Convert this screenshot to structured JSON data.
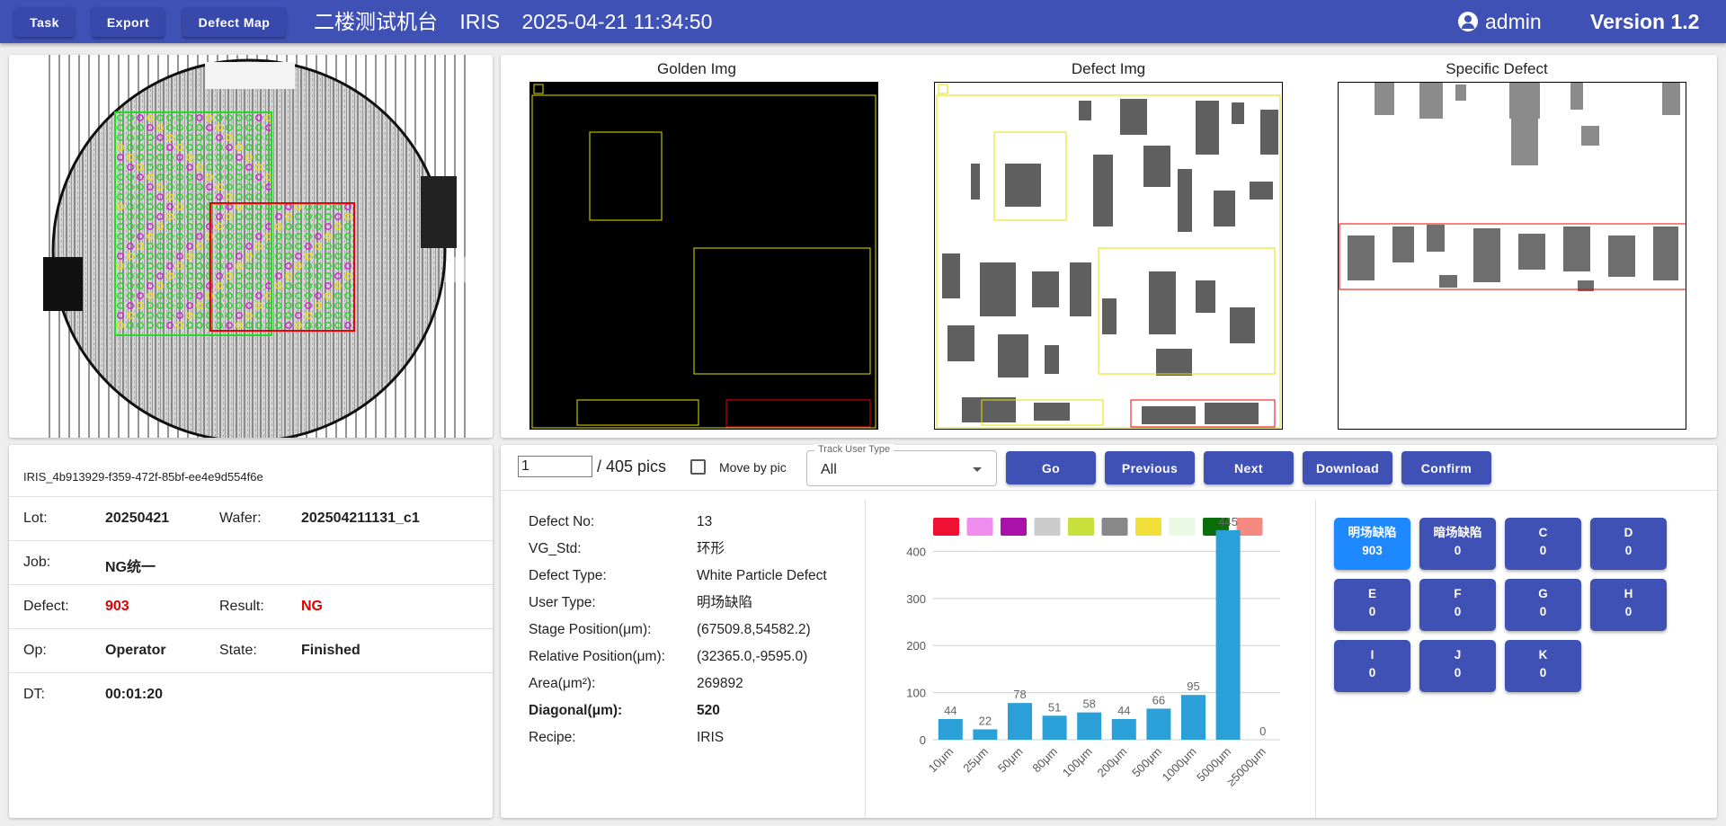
{
  "toolbar": {
    "task": "Task",
    "export": "Export",
    "defect_map": "Defect Map",
    "station": "二楼测试机台",
    "system": "IRIS",
    "datetime": "2025-04-21 11:34:50",
    "user": "admin",
    "version": "Version 1.2"
  },
  "images": {
    "golden_title": "Golden Img",
    "defect_title": "Defect Img",
    "specific_title": "Specific Defect"
  },
  "info": {
    "id": "IRIS_4b913929-f359-472f-85bf-ee4e9d554f6e",
    "lot_label": "Lot:",
    "lot": "20250421",
    "wafer_label": "Wafer:",
    "wafer": "202504211131_c1",
    "job_label": "Job:",
    "job": "NG统一",
    "defect_label": "Defect:",
    "defect": "903",
    "result_label": "Result:",
    "result": "NG",
    "op_label": "Op:",
    "op": "Operator",
    "state_label": "State:",
    "state": "Finished",
    "dt_label": "DT:",
    "dt": "00:01:20"
  },
  "controls": {
    "pic_value": "1",
    "pic_total": "/ 405 pics",
    "move_by_pic": "Move by pic",
    "move_by_pic_checked": false,
    "track_label": "Track User Type",
    "track_value": "All",
    "go": "Go",
    "previous": "Previous",
    "next": "Next",
    "download": "Download",
    "confirm": "Confirm"
  },
  "defect": {
    "no_label": "Defect No:",
    "no": "13",
    "vg_label": "VG_Std:",
    "vg": "环形",
    "type_label": "Defect Type:",
    "type": "White Particle Defect",
    "user_type_label": "User Type:",
    "user_type": "明场缺陷",
    "stage_label": "Stage Position(μm):",
    "stage": "(67509.8,54582.2)",
    "rel_label": "Relative Position(μm):",
    "rel": "(32365.0,-9595.0)",
    "area_label": "Area(μm²):",
    "area": "269892",
    "diag_label": "Diagonal(μm):",
    "diag": "520",
    "recipe_label": "Recipe:",
    "recipe": "IRIS"
  },
  "legend_colors": [
    "#ee1133",
    "#f08ef0",
    "#aa11aa",
    "#cccccc",
    "#c8e03c",
    "#888888",
    "#f2df3a",
    "#e9f9e4",
    "#0a6e0a",
    "#f58a80"
  ],
  "chart_data": {
    "type": "bar",
    "categories": [
      "10μm",
      "25μm",
      "50μm",
      "80μm",
      "100μm",
      "200μm",
      "500μm",
      "1000μm",
      "5000μm",
      "≥5000μm"
    ],
    "values": [
      44,
      22,
      78,
      51,
      58,
      44,
      66,
      95,
      445,
      0
    ],
    "yticks": [
      0,
      100,
      200,
      300,
      400
    ],
    "ylim": [
      0,
      460
    ],
    "bar_color": "#2a9fd8",
    "grid": true
  },
  "type_buttons": [
    {
      "label": "明场缺陷",
      "count": "903",
      "active": true
    },
    {
      "label": "暗场缺陷",
      "count": "0",
      "active": false
    },
    {
      "label": "C",
      "count": "0",
      "active": false
    },
    {
      "label": "D",
      "count": "0",
      "active": false
    },
    {
      "label": "E",
      "count": "0",
      "active": false
    },
    {
      "label": "F",
      "count": "0",
      "active": false
    },
    {
      "label": "G",
      "count": "0",
      "active": false
    },
    {
      "label": "H",
      "count": "0",
      "active": false
    },
    {
      "label": "I",
      "count": "0",
      "active": false
    },
    {
      "label": "J",
      "count": "0",
      "active": false
    },
    {
      "label": "K",
      "count": "0",
      "active": false
    }
  ]
}
